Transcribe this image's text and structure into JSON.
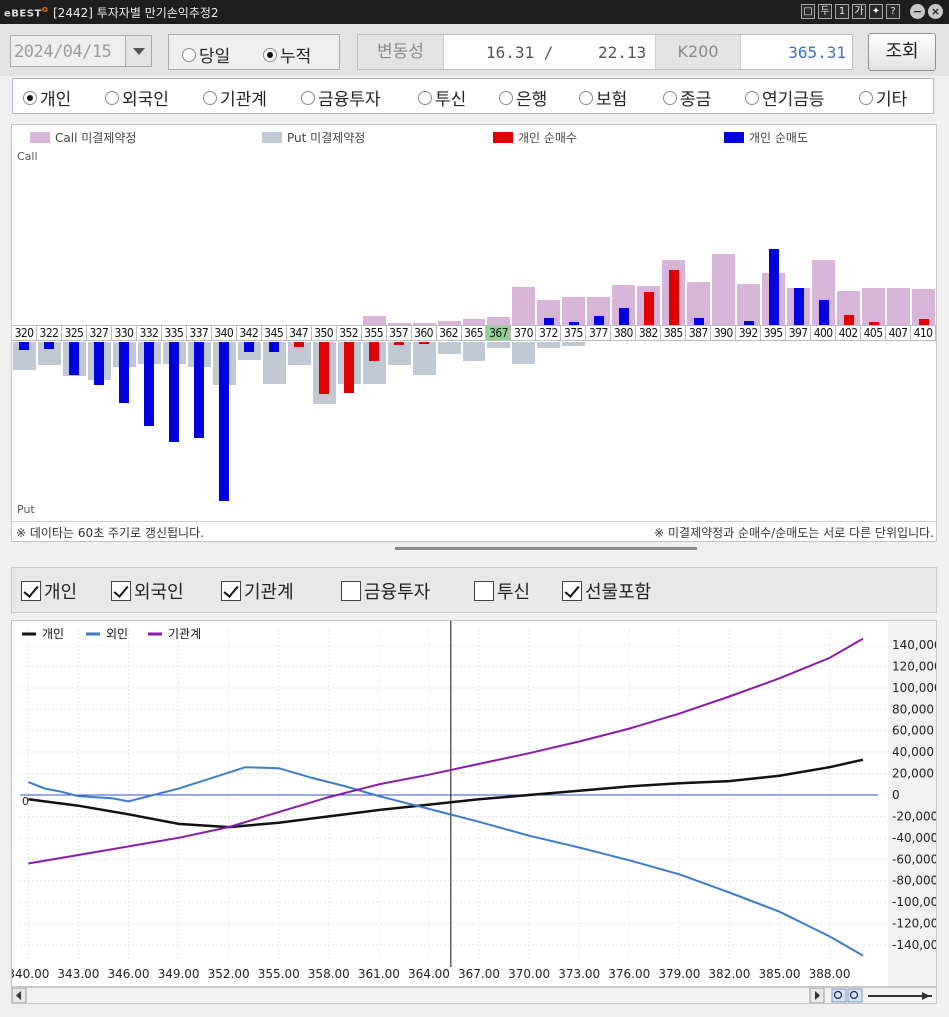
{
  "window": {
    "logo": "eBEST",
    "title": "[2442] 투자자별 만기손익추정2",
    "controls": [
      "□",
      "두",
      "1",
      "가",
      "✦",
      "?"
    ]
  },
  "toolbar": {
    "date": "2024/04/15",
    "period_options": [
      {
        "label": "당일",
        "selected": false
      },
      {
        "label": "누적",
        "selected": true
      }
    ],
    "volatility_label": "변동성",
    "volatility_1": "16.31 /",
    "volatility_2": "22.13",
    "k200_label": "K200",
    "k200_value": "365.31",
    "query_label": "조회"
  },
  "investors": [
    {
      "label": "개인",
      "selected": true
    },
    {
      "label": "외국인",
      "selected": false
    },
    {
      "label": "기관계",
      "selected": false
    },
    {
      "label": "금융투자",
      "selected": false
    },
    {
      "label": "투신",
      "selected": false
    },
    {
      "label": "은행",
      "selected": false
    },
    {
      "label": "보험",
      "selected": false
    },
    {
      "label": "종금",
      "selected": false
    },
    {
      "label": "연기금등",
      "selected": false
    },
    {
      "label": "기타",
      "selected": false
    }
  ],
  "colors": {
    "call_oi": "#d8b4d8",
    "put_oi": "#c0c8d4",
    "net_buy": "#e00000",
    "net_sell": "#0000e0",
    "line_indiv": "#111111",
    "line_foreign": "#3d7cc9",
    "line_inst": "#8a1aa8"
  },
  "chart_data": [
    {
      "type": "bar",
      "legend": [
        "Call 미결제약정",
        "Put 미결제약정",
        "개인 순매수",
        "개인 순매도"
      ],
      "call_label": "Call",
      "put_label": "Put",
      "atm_strike": "367",
      "strikes": [
        "320",
        "322",
        "325",
        "327",
        "330",
        "332",
        "335",
        "337",
        "340",
        "342",
        "345",
        "347",
        "350",
        "352",
        "355",
        "357",
        "360",
        "362",
        "365",
        "367",
        "370",
        "372",
        "375",
        "377",
        "380",
        "382",
        "385",
        "387",
        "390",
        "392",
        "395",
        "397",
        "400",
        "402",
        "405",
        "407",
        "410"
      ],
      "call_oi": [
        0,
        0,
        0,
        0,
        0,
        0,
        0,
        0,
        0,
        0,
        0,
        0,
        0,
        0,
        9,
        2,
        2,
        4,
        6,
        8,
        38,
        25,
        28,
        28,
        40,
        39,
        65,
        43,
        71,
        41,
        52,
        37,
        65,
        34,
        37,
        37,
        36
      ],
      "put_oi": [
        28,
        23,
        34,
        38,
        25,
        22,
        22,
        25,
        43,
        18,
        42,
        23,
        62,
        42,
        42,
        23,
        33,
        12,
        19,
        6,
        22,
        6,
        4,
        0,
        0,
        0,
        0,
        0,
        0,
        0,
        0,
        0,
        0,
        0,
        0,
        0,
        0
      ],
      "indiv_buy": [
        0,
        0,
        0,
        0,
        0,
        0,
        0,
        0,
        0,
        0,
        0,
        0,
        0,
        0,
        0,
        0,
        0,
        0,
        0,
        0,
        0,
        0,
        0,
        0,
        0,
        33,
        55,
        0,
        0,
        0,
        0,
        0,
        0,
        10,
        3,
        0,
        6
      ],
      "indiv_buy_neg": [
        0,
        0,
        0,
        0,
        0,
        0,
        0,
        0,
        0,
        0,
        0,
        5,
        52,
        51,
        19,
        3,
        2,
        0,
        0,
        0,
        0,
        0,
        0,
        0,
        0,
        0,
        0,
        0,
        0,
        0,
        0,
        0,
        0,
        0,
        0,
        0,
        0
      ],
      "indiv_sell": [
        0,
        0,
        0,
        0,
        0,
        0,
        0,
        0,
        0,
        0,
        0,
        0,
        0,
        0,
        0,
        0,
        0,
        0,
        0,
        0,
        0,
        7,
        3,
        9,
        17,
        0,
        0,
        7,
        0,
        4,
        76,
        37,
        25,
        0,
        0,
        0,
        0
      ],
      "indiv_sell_neg": [
        8,
        7,
        33,
        43,
        61,
        84,
        100,
        96,
        159,
        10,
        10,
        0,
        0,
        0,
        0,
        0,
        0,
        0,
        0,
        0,
        0,
        0,
        0,
        0,
        0,
        0,
        0,
        0,
        0,
        0,
        0,
        0,
        0,
        0,
        0,
        0,
        0
      ],
      "note_left": "※ 데이타는 60초 주기로 갱신됩니다.",
      "note_right": "※ 미결제약정과 순매수/순매도는 서로 다른 단위입니다."
    },
    {
      "type": "line",
      "legend": [
        "개인",
        "외인",
        "기관계"
      ],
      "x_labels": [
        "340.00",
        "343.00",
        "346.00",
        "349.00",
        "352.00",
        "355.00",
        "358.00",
        "361.00",
        "364.00",
        "367.00",
        "370.00",
        "373.00",
        "376.00",
        "379.00",
        "382.00",
        "385.00",
        "388.00"
      ],
      "y_labels": [
        "140,000",
        "120,000",
        "100,000",
        "80,000",
        "60,000",
        "40,000",
        "20,000",
        "0",
        "-20,000",
        "-40,000",
        "-60,000",
        "-80,000",
        "-100,000",
        "-120,000",
        "-140,000"
      ],
      "ylim": [
        -155000,
        155000
      ],
      "xlim": [
        339.5,
        391.5
      ],
      "cursor_x": 365.31,
      "series": [
        {
          "name": "개인",
          "x": [
            340,
            343,
            346,
            349,
            352,
            355,
            358,
            361,
            364,
            367,
            370,
            373,
            376,
            379,
            382,
            385,
            388,
            390
          ],
          "y": [
            -4000,
            -10000,
            -18000,
            -27000,
            -30000,
            -26000,
            -20000,
            -14000,
            -9000,
            -4000,
            0,
            4000,
            8000,
            11000,
            13000,
            18000,
            26000,
            33000
          ]
        },
        {
          "name": "외인",
          "x": [
            340,
            341,
            342,
            343,
            345,
            346,
            347,
            349,
            351,
            353,
            355,
            357,
            359,
            361,
            364,
            367,
            370,
            373,
            376,
            379,
            382,
            385,
            388,
            390
          ],
          "y": [
            12000,
            6000,
            3000,
            -1000,
            -3000,
            -6000,
            -2000,
            6000,
            16000,
            26000,
            25000,
            16000,
            8000,
            -1000,
            -13000,
            -25000,
            -38000,
            -49000,
            -61000,
            -74000,
            -91000,
            -109000,
            -132000,
            -150000
          ]
        },
        {
          "name": "기관계",
          "x": [
            340,
            343,
            346,
            349,
            352,
            355,
            358,
            361,
            364,
            367,
            370,
            373,
            376,
            379,
            382,
            385,
            388,
            390
          ],
          "y": [
            -64000,
            -56000,
            -48000,
            -40000,
            -30000,
            -16000,
            -2000,
            10000,
            19000,
            29000,
            39000,
            50000,
            62000,
            76000,
            92000,
            109000,
            128000,
            146000
          ]
        }
      ]
    }
  ],
  "series_toggles": [
    {
      "label": "개인",
      "checked": true
    },
    {
      "label": "외국인",
      "checked": true
    },
    {
      "label": "기관계",
      "checked": true
    },
    {
      "label": "금융투자",
      "checked": false
    },
    {
      "label": "투신",
      "checked": false
    },
    {
      "label": "선물포함",
      "checked": true
    }
  ]
}
